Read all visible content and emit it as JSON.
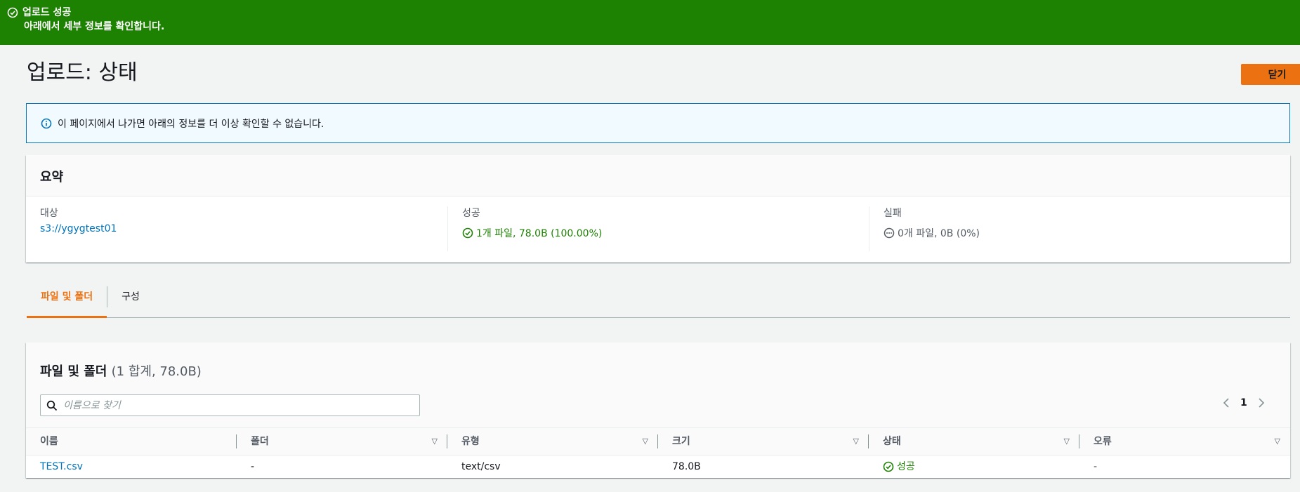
{
  "flash": {
    "title": "업로드 성공",
    "message": "아래에서 세부 정보를 확인합니다.",
    "icon": "check-circle-icon",
    "color": "#1d8102"
  },
  "header": {
    "title": "업로드: 상태",
    "close_label": "닫기"
  },
  "info": {
    "icon": "info-circle-icon",
    "text": "이 페이지에서 나가면 아래의 정보를 더 이상 확인할 수 없습니다."
  },
  "summary": {
    "title": "요약",
    "target_label": "대상",
    "target_value": "s3://ygygtest01",
    "success_label": "성공",
    "success_value": "1개 파일, 78.0B (100.00%)",
    "fail_label": "실패",
    "fail_value": "0개 파일, 0B (0%)"
  },
  "tabs": [
    {
      "label": "파일 및 폴더",
      "active": true
    },
    {
      "label": "구성",
      "active": false
    }
  ],
  "files": {
    "title": "파일 및 폴더",
    "count": "(1 합계, 78.0B)",
    "search_placeholder": "이름으로 찾기",
    "page": "1",
    "columns": [
      "이름",
      "폴더",
      "유형",
      "크기",
      "상태",
      "오류"
    ],
    "rows": [
      {
        "name": "TEST.csv",
        "folder": "-",
        "type": "text/csv",
        "size": "78.0B",
        "status": "성공",
        "error": "-"
      }
    ]
  },
  "colors": {
    "accent": "#ec7211",
    "link": "#0073bb",
    "success": "#1d8102"
  }
}
